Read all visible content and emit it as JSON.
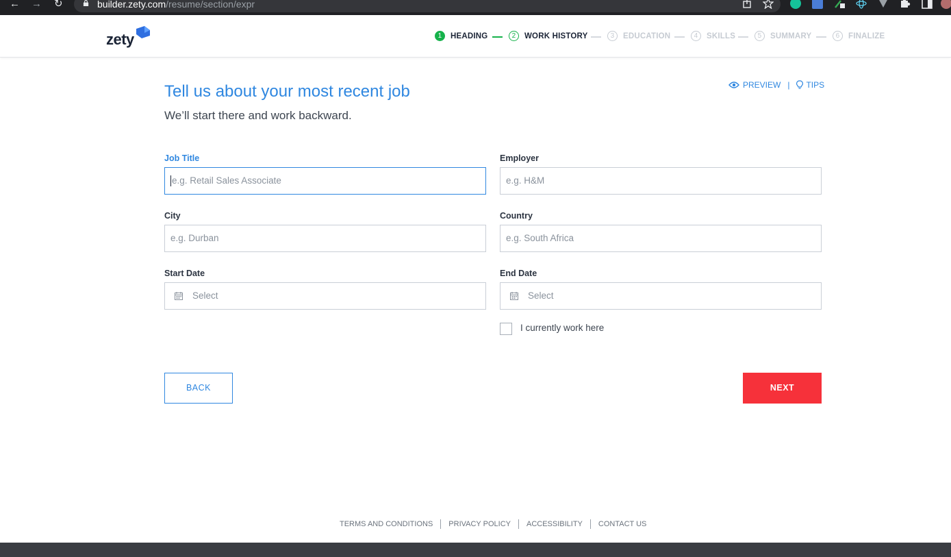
{
  "browser": {
    "back": "←",
    "forward": "→",
    "reload": "↻",
    "url_host": "builder.zety.com",
    "url_path": "/resume/section/expr"
  },
  "header": {
    "logo": "zety",
    "steps": [
      {
        "num": "1",
        "label": "HEADING",
        "state": "done"
      },
      {
        "num": "2",
        "label": "WORK HISTORY",
        "state": "active"
      },
      {
        "num": "3",
        "label": "EDUCATION",
        "state": "pending"
      },
      {
        "num": "4",
        "label": "SKILLS",
        "state": "pending"
      },
      {
        "num": "5",
        "label": "SUMMARY",
        "state": "pending"
      },
      {
        "num": "6",
        "label": "FINALIZE",
        "state": "pending"
      }
    ]
  },
  "main": {
    "title": "Tell us about your most recent job",
    "subtitle": "We’ll start there and work backward.",
    "preview_label": "PREVIEW",
    "tips_label": "TIPS",
    "separator": "|"
  },
  "form": {
    "job_title": {
      "label": "Job Title",
      "placeholder": "e.g. Retail Sales Associate"
    },
    "employer": {
      "label": "Employer",
      "placeholder": "e.g. H&M"
    },
    "city": {
      "label": "City",
      "placeholder": "e.g. Durban"
    },
    "country": {
      "label": "Country",
      "placeholder": "e.g. South Africa"
    },
    "start_date": {
      "label": "Start Date",
      "placeholder": "Select"
    },
    "end_date": {
      "label": "End Date",
      "placeholder": "Select"
    },
    "current_checkbox_label": "I currently work here"
  },
  "buttons": {
    "back": "BACK",
    "next": "NEXT"
  },
  "footer": {
    "links": [
      "TERMS AND CONDITIONS",
      "PRIVACY POLICY",
      "ACCESSIBILITY",
      "CONTACT US"
    ]
  },
  "colors": {
    "accent_blue": "#2f87e0",
    "step_green": "#16b24b",
    "next_red": "#f6313a",
    "logo_navy": "#1b2436"
  }
}
